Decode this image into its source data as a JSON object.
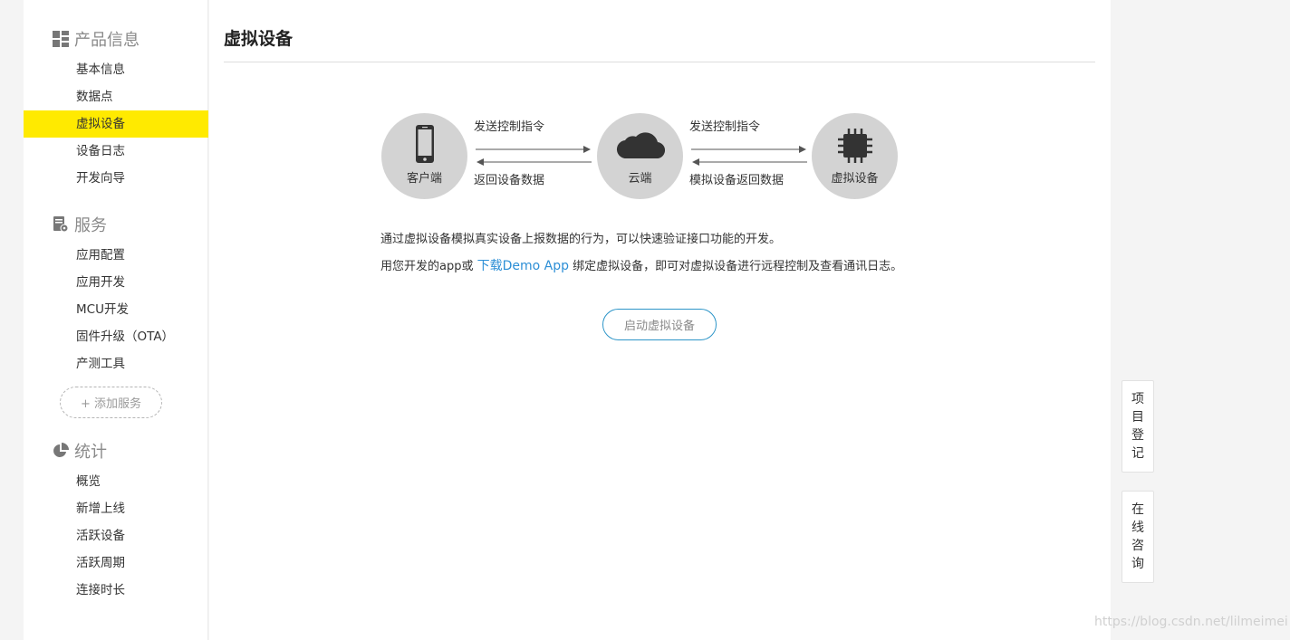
{
  "sidebar": {
    "sections": [
      {
        "title": "产品信息",
        "icon": "grid-icon",
        "items": [
          "基本信息",
          "数据点",
          "虚拟设备",
          "设备日志",
          "开发向导"
        ]
      },
      {
        "title": "服务",
        "icon": "service-settings-icon",
        "items": [
          "应用配置",
          "应用开发",
          "MCU开发",
          "固件升级（OTA）",
          "产测工具"
        ]
      },
      {
        "title": "统计",
        "icon": "pie-chart-icon",
        "items": [
          "概览",
          "新增上线",
          "活跃设备",
          "活跃周期",
          "连接时长"
        ]
      }
    ],
    "active_item": "虚拟设备",
    "add_service": "+ 添加服务"
  },
  "main": {
    "title": "虚拟设备",
    "diagram": {
      "client": "客户端",
      "cloud": "云端",
      "device": "虚拟设备",
      "send_cmd_1": "发送控制指令",
      "return_data": "返回设备数据",
      "send_cmd_2": "发送控制指令",
      "virtual_return": "模拟设备返回数据"
    },
    "desc_line1": "通过虚拟设备模拟真实设备上报数据的行为，可以快速验证接口功能的开发。",
    "desc_line2_prefix": "用您开发的app或 ",
    "desc_line2_link": "下载Demo App",
    "desc_line2_suffix": " 绑定虚拟设备，即可对虚拟设备进行远程控制及查看通讯日志。",
    "start_button": "启动虚拟设备"
  },
  "floating": {
    "register": [
      "项",
      "目",
      "登",
      "记"
    ],
    "consult": [
      "在",
      "线",
      "咨",
      "询"
    ]
  },
  "watermark": "https://blog.csdn.net/lilmeimei",
  "colors": {
    "active_bg": "#ffea00",
    "link": "#2d8fd6",
    "button_border": "#2d95c8",
    "circle": "#d3d3d3"
  }
}
